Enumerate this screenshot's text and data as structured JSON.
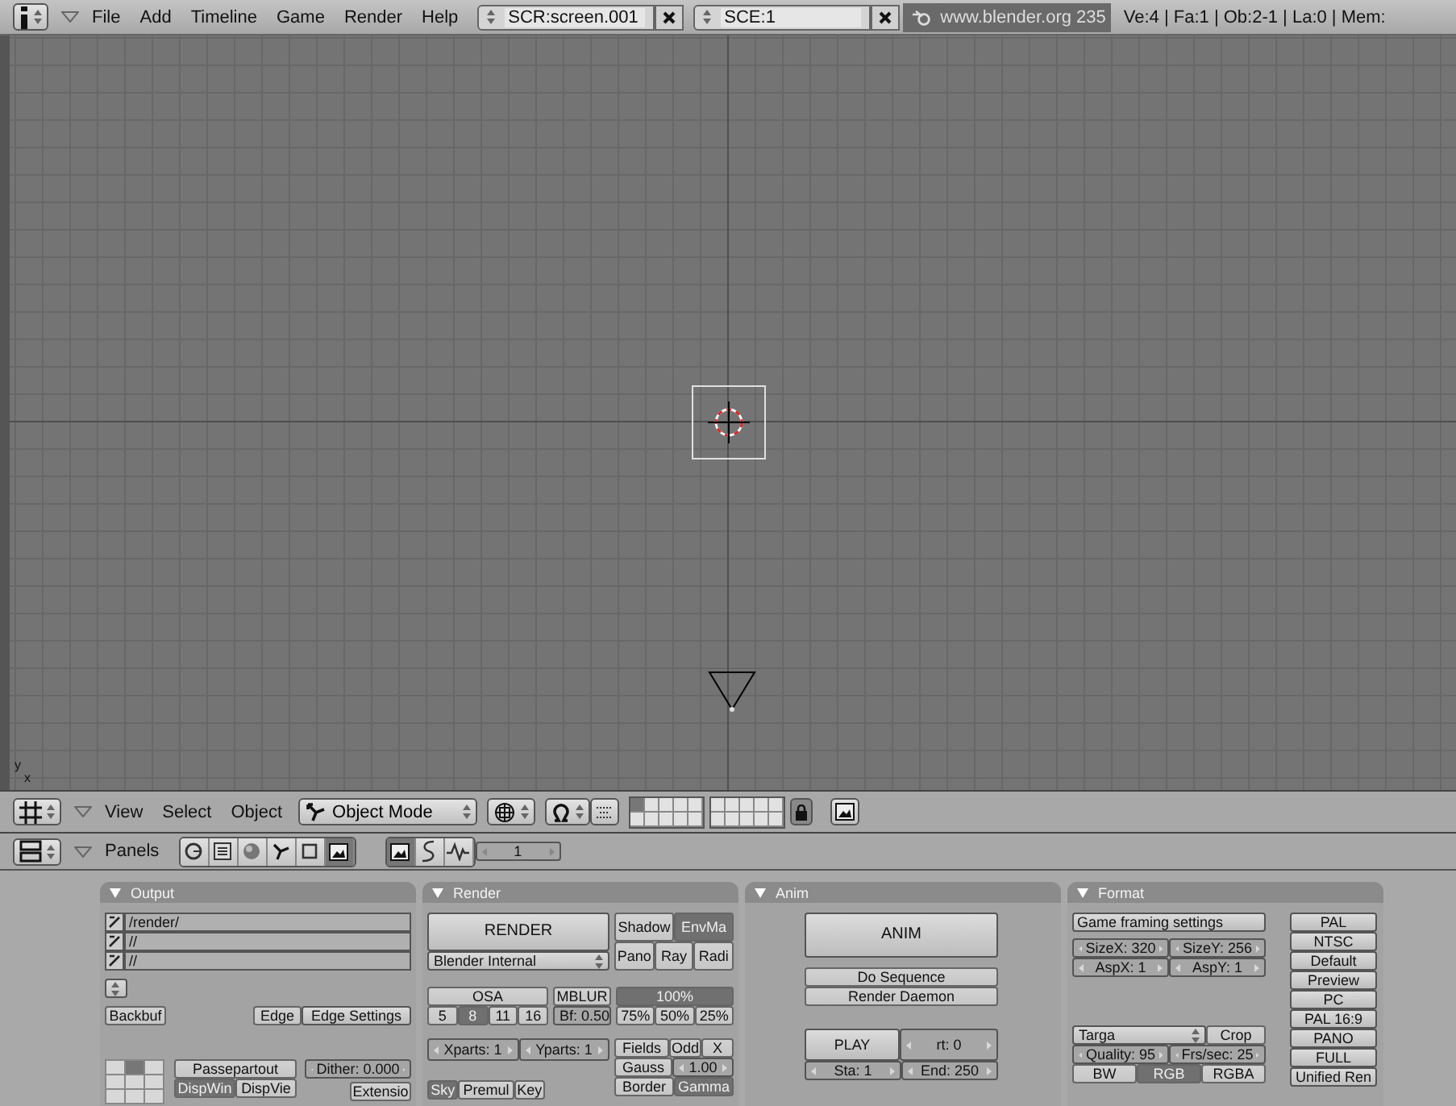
{
  "top_bar": {
    "menus": [
      "File",
      "Add",
      "Timeline",
      "Game",
      "Render",
      "Help"
    ],
    "screen": "SCR:screen.001",
    "scene": "SCE:1",
    "version": "www.blender.org 235",
    "stats": "Ve:4 | Fa:1 | Ob:2-1 | La:0 | Mem:"
  },
  "viewport": {
    "axis_labels": [
      "y",
      "x"
    ]
  },
  "view_header": {
    "menus": [
      "View",
      "Select",
      "Object"
    ],
    "mode": "Object Mode",
    "layers": [
      {
        "selected": true
      },
      {
        "selected": false
      },
      {
        "selected": false
      },
      {
        "selected": false
      },
      {
        "selected": false
      },
      {
        "selected": false
      },
      {
        "selected": false
      },
      {
        "selected": false
      },
      {
        "selected": false
      },
      {
        "selected": false
      },
      {
        "selected": false
      },
      {
        "selected": false
      },
      {
        "selected": false
      },
      {
        "selected": false
      },
      {
        "selected": false
      },
      {
        "selected": false
      },
      {
        "selected": false
      },
      {
        "selected": false
      },
      {
        "selected": false
      },
      {
        "selected": false
      }
    ],
    "lock": {
      "on": true
    }
  },
  "buttons_header": {
    "label": "Panels",
    "context_tabs": [
      {
        "selected": false
      },
      {
        "selected": false
      },
      {
        "selected": false
      },
      {
        "selected": false
      },
      {
        "selected": false
      },
      {
        "selected": true
      }
    ],
    "subcontext_tabs": [
      {
        "selected": true
      },
      {
        "selected": false
      },
      {
        "selected": false
      }
    ],
    "frame": "1"
  },
  "panels": [
    {
      "title": "Output",
      "paths": [
        {
          "value": "/render/"
        },
        {
          "value": "//"
        },
        {
          "value": "//"
        }
      ],
      "type_menu": {
        "kind": "menu"
      },
      "backbuf": {
        "kind": "toggle",
        "label": "Backbuf",
        "on": false
      },
      "edge": [
        {
          "kind": "toggle",
          "label": "Edge",
          "on": false
        },
        {
          "kind": "button",
          "label": "Edge Settings"
        }
      ],
      "position_grid": [
        {
          "selected": false
        },
        {
          "selected": true
        },
        {
          "selected": false
        },
        {
          "selected": false
        },
        {
          "selected": false
        },
        {
          "selected": false
        },
        {
          "selected": false
        },
        {
          "selected": false
        },
        {
          "selected": false
        }
      ],
      "passepartout": {
        "kind": "toggle",
        "label": "Passepartout",
        "on": false
      },
      "display": [
        {
          "kind": "toggle",
          "label": "DispWin",
          "on": true
        },
        {
          "kind": "toggle",
          "label": "DispVie",
          "on": false
        }
      ],
      "dither": {
        "kind": "number",
        "label": "Dither: 0.000"
      },
      "extension": {
        "kind": "toggle",
        "label": "Extensio",
        "on": false
      }
    },
    {
      "title": "Render",
      "render": {
        "kind": "button",
        "label": "RENDER"
      },
      "renderer": {
        "kind": "menu",
        "label": "Blender Internal"
      },
      "options": [
        [
          {
            "kind": "toggle",
            "label": "Shadow",
            "on": false
          },
          {
            "kind": "toggle",
            "label": "EnvMa",
            "on": true
          }
        ],
        [
          {
            "kind": "toggle",
            "label": "Pano",
            "on": false
          },
          {
            "kind": "toggle",
            "label": "Ray",
            "on": false
          },
          {
            "kind": "toggle",
            "label": "Radi",
            "on": false
          }
        ]
      ],
      "osa": {
        "kind": "toggle",
        "label": "OSA",
        "on": false
      },
      "osa_levels": [
        {
          "kind": "toggle",
          "label": "5",
          "on": false
        },
        {
          "kind": "toggle",
          "label": "8",
          "on": true
        },
        {
          "kind": "toggle",
          "label": "11",
          "on": false
        },
        {
          "kind": "toggle",
          "label": "16",
          "on": false
        }
      ],
      "mblur": {
        "kind": "toggle",
        "label": "MBLUR",
        "on": false
      },
      "blur_factor": {
        "kind": "field",
        "label": "Bf: 0.50"
      },
      "size": {
        "kind": "toggle",
        "label": "100%",
        "on": true
      },
      "size_presets": [
        {
          "kind": "toggle",
          "label": "75%",
          "on": false
        },
        {
          "kind": "toggle",
          "label": "50%",
          "on": false
        },
        {
          "kind": "toggle",
          "label": "25%",
          "on": false
        }
      ],
      "parts": [
        {
          "kind": "number",
          "label": "Xparts: 1"
        },
        {
          "kind": "number",
          "label": "Yparts: 1"
        }
      ],
      "alpha": [
        {
          "kind": "toggle",
          "label": "Sky",
          "on": true
        },
        {
          "kind": "toggle",
          "label": "Premul",
          "on": false
        },
        {
          "kind": "toggle",
          "label": "Key",
          "on": false
        }
      ],
      "fields": [
        [
          {
            "kind": "toggle",
            "label": "Fields",
            "on": false
          },
          {
            "kind": "toggle",
            "label": "Odd",
            "on": false
          },
          {
            "kind": "toggle",
            "label": "X",
            "on": false
          }
        ],
        [
          {
            "kind": "toggle",
            "label": "Gauss",
            "on": false
          },
          {
            "kind": "number",
            "label": "1.00"
          }
        ],
        [
          {
            "kind": "toggle",
            "label": "Border",
            "on": false
          },
          {
            "kind": "toggle",
            "label": "Gamma",
            "on": true
          }
        ]
      ]
    },
    {
      "title": "Anim",
      "anim": {
        "kind": "button",
        "label": "ANIM"
      },
      "sequence": [
        {
          "kind": "toggle",
          "label": "Do Sequence",
          "on": false
        },
        {
          "kind": "toggle",
          "label": "Render Daemon",
          "on": false
        }
      ],
      "play": {
        "kind": "button",
        "label": "PLAY"
      },
      "rate": {
        "kind": "number",
        "label": "rt: 0"
      },
      "range": [
        {
          "kind": "number",
          "label": "Sta: 1"
        },
        {
          "kind": "number",
          "label": "End: 250"
        }
      ]
    },
    {
      "title": "Format",
      "game_framing": {
        "kind": "button",
        "label": "Game framing settings"
      },
      "size": [
        [
          {
            "kind": "number",
            "label": "SizeX: 320"
          },
          {
            "kind": "number",
            "label": "SizeY: 256"
          }
        ],
        [
          {
            "kind": "number",
            "label": "AspX: 1"
          },
          {
            "kind": "number",
            "label": "AspY: 1"
          }
        ]
      ],
      "file_type": {
        "kind": "menu",
        "label": "Targa"
      },
      "crop": {
        "kind": "toggle",
        "label": "Crop",
        "on": false
      },
      "quality": [
        {
          "kind": "number",
          "label": "Quality: 95"
        },
        {
          "kind": "number",
          "label": "Frs/sec: 25"
        }
      ],
      "color": [
        {
          "kind": "toggle",
          "label": "BW",
          "on": false
        },
        {
          "kind": "toggle",
          "label": "RGB",
          "on": true
        },
        {
          "kind": "toggle",
          "label": "RGBA",
          "on": false
        }
      ],
      "presets": [
        {
          "kind": "button",
          "label": "PAL"
        },
        {
          "kind": "button",
          "label": "NTSC"
        },
        {
          "kind": "button",
          "label": "Default"
        },
        {
          "kind": "button",
          "label": "Preview"
        },
        {
          "kind": "button",
          "label": "PC"
        },
        {
          "kind": "button",
          "label": "PAL 16:9"
        },
        {
          "kind": "button",
          "label": "PANO"
        },
        {
          "kind": "button",
          "label": "FULL"
        },
        {
          "kind": "button",
          "label": "Unified Ren"
        }
      ]
    }
  ]
}
